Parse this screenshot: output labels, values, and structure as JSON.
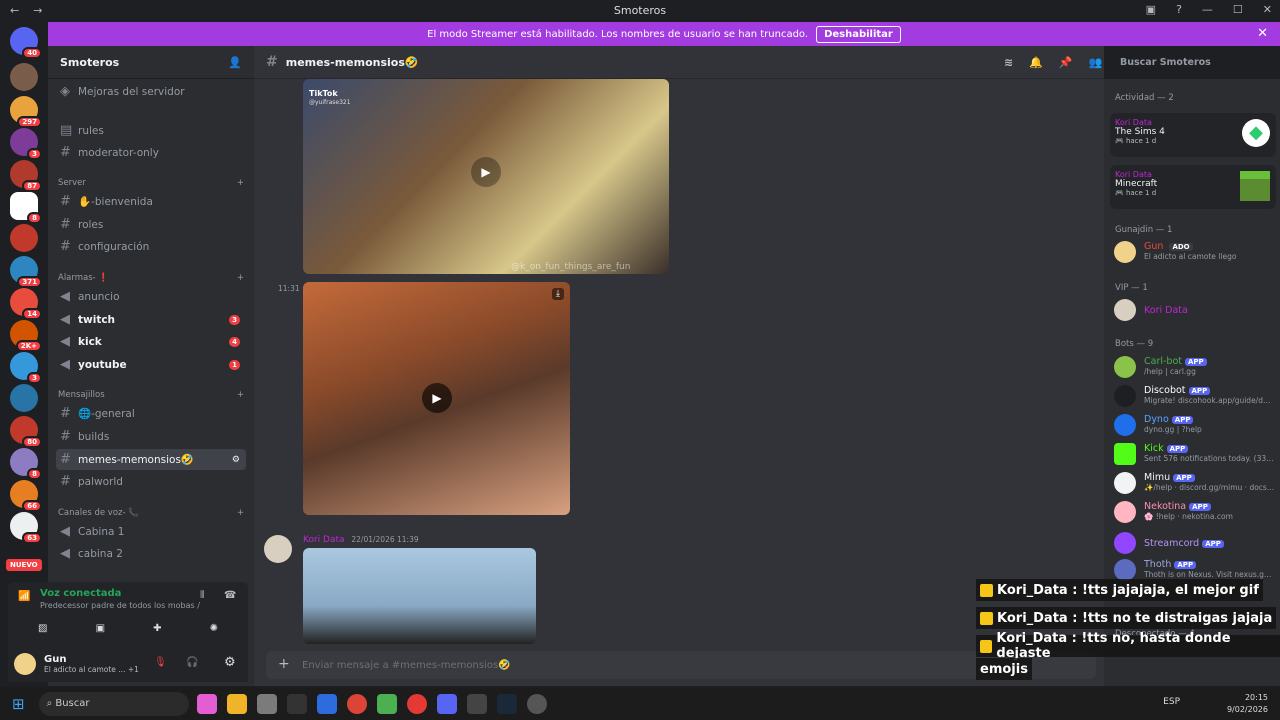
{
  "window": {
    "title": "Smoteros",
    "back": "←",
    "forward": "→"
  },
  "streamer_banner": {
    "text": "El modo Streamer está habilitado. Los nombres de usuario se han truncado.",
    "button": "Deshabilitar"
  },
  "server_list": {
    "badges": [
      "40",
      "297",
      "3",
      "87",
      "",
      "8",
      "",
      "371",
      "14",
      "2K+",
      "3",
      "",
      "80",
      "8",
      "66",
      "63"
    ],
    "new_label": "NUEVO"
  },
  "sidebar": {
    "server_name": "Smoteros",
    "boost": "Mejoras del servidor",
    "channels": [
      {
        "name": "rules",
        "type": "rules"
      },
      {
        "name": "moderator-only",
        "type": "text"
      }
    ],
    "categories": [
      {
        "label": "Server",
        "channels": [
          {
            "name": "✋-bienvenida"
          },
          {
            "name": "roles"
          },
          {
            "name": "configuración"
          }
        ]
      },
      {
        "label": "Alarmas- ❗",
        "channels": [
          {
            "name": "anuncio",
            "bold": false
          },
          {
            "name": "twitch",
            "bold": true,
            "count": "3"
          },
          {
            "name": "kick",
            "bold": true,
            "count": "4"
          },
          {
            "name": "youtube",
            "bold": true,
            "count": "1"
          }
        ]
      },
      {
        "label": "Mensajillos",
        "channels": [
          {
            "name": "🌐-general"
          },
          {
            "name": "builds"
          },
          {
            "name": "memes-memonsios🤣",
            "active": true
          },
          {
            "name": "palworld"
          }
        ]
      },
      {
        "label": "Canales de voz- 📞",
        "channels": [
          {
            "name": "Cabina 1"
          },
          {
            "name": "cabina 2"
          }
        ]
      }
    ],
    "voice": {
      "status": "Voz conectada",
      "detail": "Predecessor padre de todos los mobas / ..."
    },
    "user": {
      "name": "Gun",
      "status": "El adicto al camote ...",
      "extra": "+1"
    }
  },
  "main": {
    "channel": "memes-memonsios🤣",
    "time1": "11:31",
    "video1_caption": "TikTok",
    "video1_handle": "@yuifrase321",
    "video1_watermark": "@k_on_fun_things_are_fun",
    "author2": "Kori Data",
    "time2": "22/01/2026 11:39",
    "composer_placeholder": "Enviar mensaje a #memes-memonsios🤣"
  },
  "search": {
    "placeholder": "Buscar Smoteros"
  },
  "members": {
    "activity_header": "Actividad — 2",
    "activities": [
      {
        "user": "Kori Data",
        "game": "The Sims 4",
        "time": "hace 1 d"
      },
      {
        "user": "Kori Data",
        "game": "Minecraft",
        "time": "hace 1 d"
      }
    ],
    "gunajdin_header": "Gunajdin — 1",
    "gunajdin_member": {
      "name": "Gun",
      "tag": "ADO",
      "status": "El adicto al camote llego"
    },
    "vip_header": "VIP — 1",
    "vip_member": "Kori Data",
    "bots_header": "Bots — 9",
    "bots": [
      {
        "name": "Carl-bot",
        "status": "/help | carl.gg",
        "color": "#4caf50"
      },
      {
        "name": "Discobot",
        "status": "Migrate! discohook.app/guide/dep...",
        "color": "#ffffff"
      },
      {
        "name": "Dyno",
        "status": "dyno.gg | ?help",
        "color": "#1f6feb"
      },
      {
        "name": "Kick",
        "status": "Sent 576 notifications today. (3388...",
        "color": "#53fc18"
      },
      {
        "name": "Mimu",
        "status": "✨/help · discord.gg/mimu · docs...",
        "color": "#ffffff"
      },
      {
        "name": "Nekotina",
        "status": "🌸 !help · nekotina.com",
        "color": "#ffb6c1"
      },
      {
        "name": "Streamcord",
        "status": "",
        "color": "#9146ff"
      },
      {
        "name": "Thoth",
        "status": "Thoth is on Nexus. Visit nexus.gg/s...",
        "color": "#5c6bc0"
      }
    ],
    "disconnected_header": "Desconectado — 4",
    "app_label": "APP"
  },
  "tts_overlay": [
    "Kori_Data : !tts jajajaja, el mejor gif",
    "Kori_Data : !tts no te distraigas jajaja",
    "Kori_Data : !tts no, hasta donde dejaste",
    "emojis"
  ],
  "taskbar": {
    "search": "Buscar",
    "lang": "ESP",
    "time": "20:15",
    "date": "9/02/2026"
  }
}
